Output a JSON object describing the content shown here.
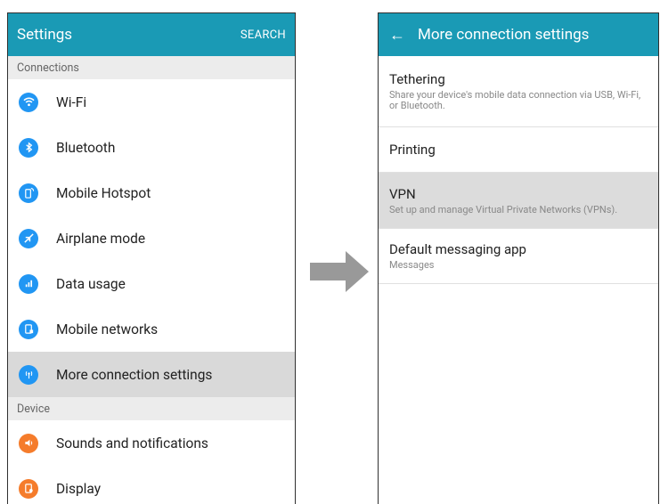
{
  "left": {
    "title": "Settings",
    "action": "SEARCH",
    "sections": [
      {
        "label": "Connections",
        "items": [
          {
            "label": "Wi-Fi",
            "icon": "wifi-icon",
            "color": "#2196f3"
          },
          {
            "label": "Bluetooth",
            "icon": "bluetooth-icon",
            "color": "#2196f3"
          },
          {
            "label": "Mobile Hotspot",
            "icon": "hotspot-icon",
            "color": "#2196f3"
          },
          {
            "label": "Airplane mode",
            "icon": "airplane-icon",
            "color": "#2196f3"
          },
          {
            "label": "Data usage",
            "icon": "data-usage-icon",
            "color": "#2196f3"
          },
          {
            "label": "Mobile networks",
            "icon": "mobile-networks-icon",
            "color": "#2196f3"
          },
          {
            "label": "More connection settings",
            "icon": "more-connection-icon",
            "color": "#2196f3",
            "selected": true
          }
        ]
      },
      {
        "label": "Device",
        "items": [
          {
            "label": "Sounds and notifications",
            "icon": "sound-icon",
            "color": "#f57c2b"
          },
          {
            "label": "Display",
            "icon": "display-icon",
            "color": "#f57c2b"
          }
        ]
      }
    ]
  },
  "right": {
    "title": "More connection settings",
    "items": [
      {
        "title": "Tethering",
        "subtitle": "Share your device's mobile data connection via USB, Wi-Fi, or Bluetooth."
      },
      {
        "title": "Printing",
        "subtitle": ""
      },
      {
        "title": "VPN",
        "subtitle": "Set up and manage Virtual Private Networks (VPNs).",
        "selected": true
      },
      {
        "title": "Default messaging app",
        "subtitle": "Messages"
      }
    ]
  },
  "colors": {
    "appbar": "#1a9ab5",
    "arrow": "#999999"
  }
}
